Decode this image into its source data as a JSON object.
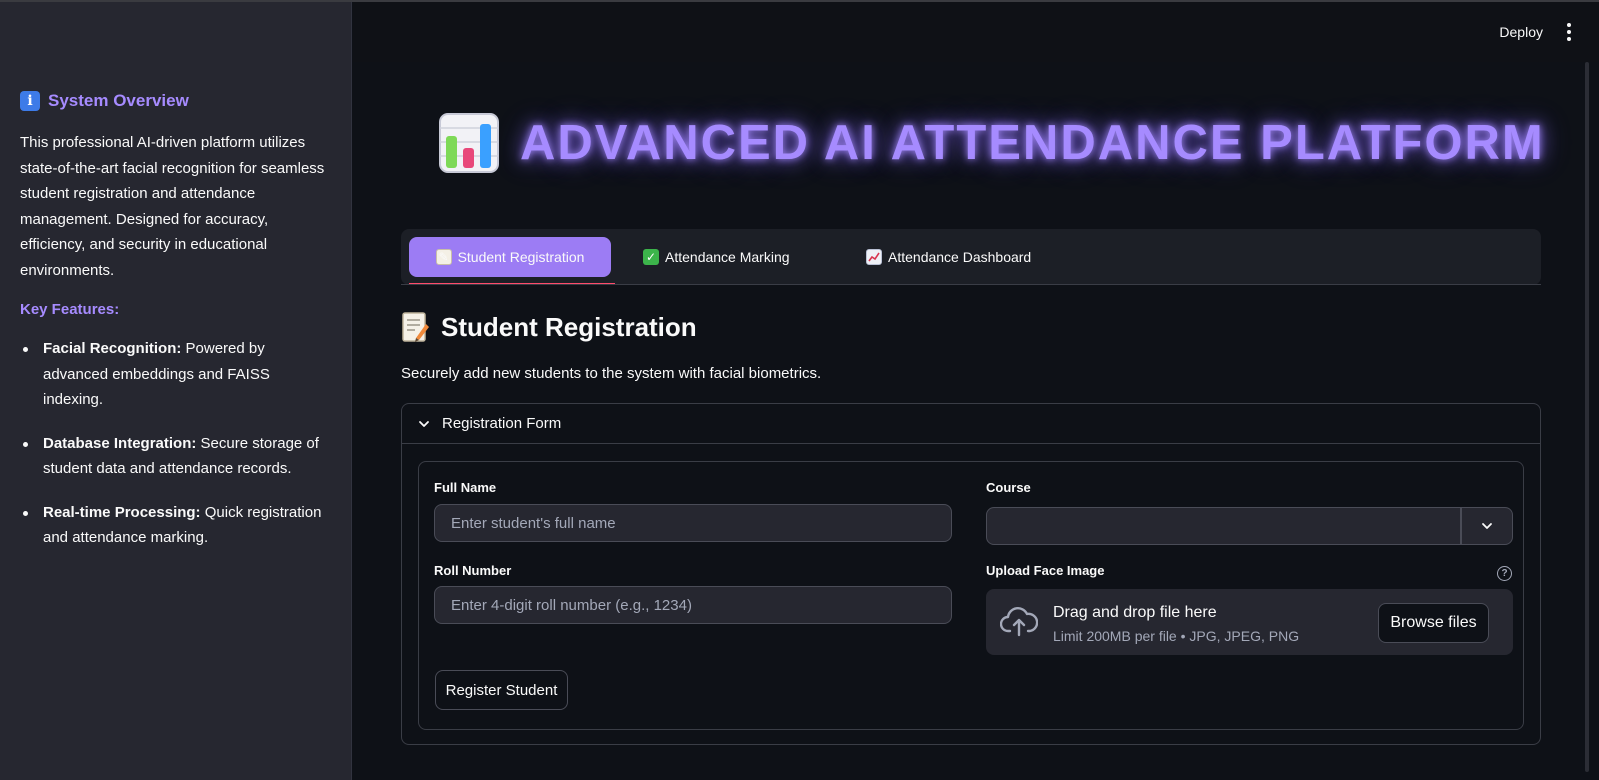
{
  "header": {
    "deploy_label": "Deploy"
  },
  "sidebar": {
    "title": "System Overview",
    "description": "This professional AI-driven platform utilizes state-of-the-art facial recognition for seamless student registration and attendance management. Designed for accuracy, efficiency, and security in educational environments.",
    "key_features_heading": "Key Features:",
    "features": [
      {
        "name": "Facial Recognition:",
        "text": " Powered by advanced embeddings and FAISS indexing."
      },
      {
        "name": "Database Integration:",
        "text": " Secure storage of student data and attendance records."
      },
      {
        "name": "Real-time Processing:",
        "text": " Quick registration and attendance marking."
      }
    ]
  },
  "hero": {
    "title": "ADVANCED AI ATTENDANCE PLATFORM"
  },
  "tabs": [
    {
      "label": "Student Registration",
      "icon": "memo-icon",
      "active": true
    },
    {
      "label": "Attendance Marking",
      "icon": "check-mark-icon",
      "active": false
    },
    {
      "label": "Attendance Dashboard",
      "icon": "chart-increasing-icon",
      "active": false
    }
  ],
  "section": {
    "title": "Student Registration",
    "subtitle": "Securely add new students to the system with facial biometrics."
  },
  "form": {
    "expander_label": "Registration Form",
    "full_name_label": "Full Name",
    "full_name_placeholder": "Enter student's full name",
    "course_label": "Course",
    "course_value": "",
    "roll_label": "Roll Number",
    "roll_placeholder": "Enter 4-digit roll number (e.g., 1234)",
    "upload_label": "Upload Face Image",
    "dropzone_main": "Drag and drop file here",
    "dropzone_sub": "Limit 200MB per file • JPG, JPEG, PNG",
    "browse_label": "Browse files",
    "register_label": "Register Student"
  },
  "colors": {
    "accent": "#a68bff",
    "active_tab": "#9c7cf4",
    "tab_underline": "#ff4b6b",
    "background": "#0e1117",
    "sidebar": "#262730"
  }
}
